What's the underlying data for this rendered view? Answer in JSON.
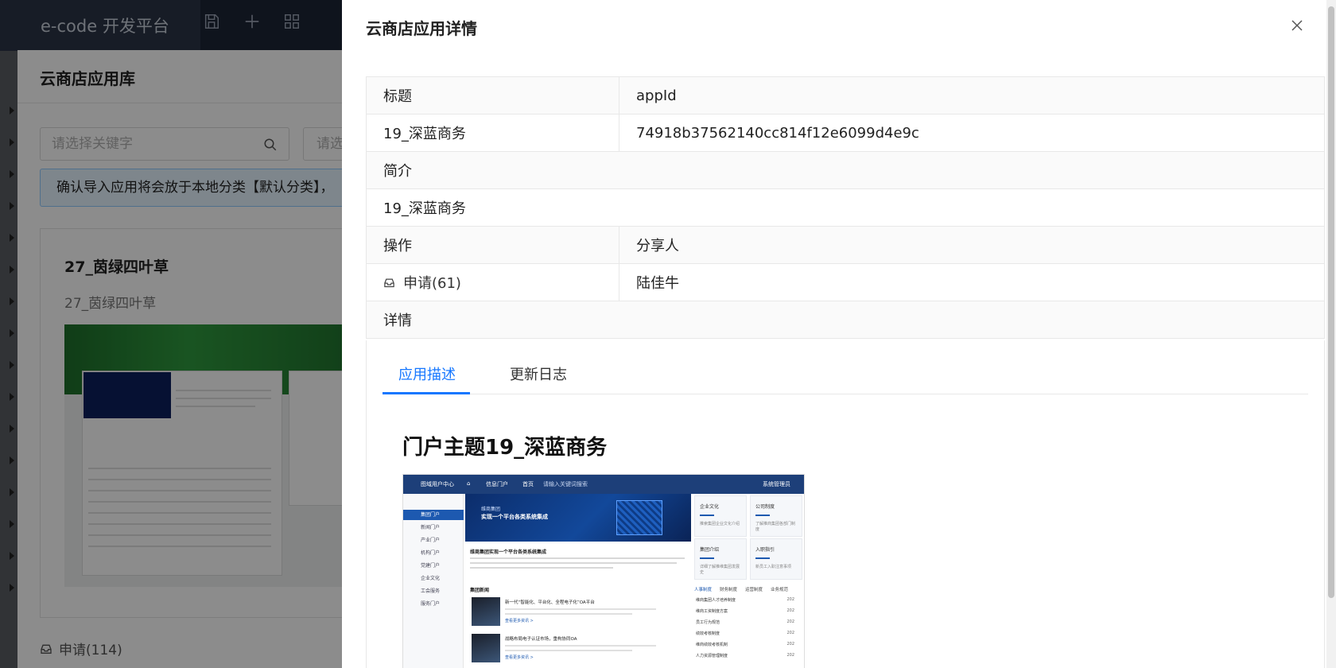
{
  "app": {
    "brand": "e-code 开发平台"
  },
  "library": {
    "title": "云商店应用库",
    "search_placeholder": "请选择关键字",
    "search2_placeholder": "请选",
    "alert_text": "确认导入应用将会放于本地分类【默认分类】，",
    "card": {
      "title": "27_茵绿四叶草",
      "subtitle": "27_茵绿四叶草"
    },
    "footer_apply": "申请(114)"
  },
  "drawer": {
    "title": "云商店应用详情",
    "table": {
      "title_label": "标题",
      "appid_label": "appId",
      "title_value": "19_深蓝商务",
      "appid_value": "74918b37562140cc814f12e6099d4e9c",
      "intro_label": "简介",
      "intro_value": "19_深蓝商务",
      "ops_label": "操作",
      "sharer_label": "分享人",
      "apply_label": "申请(61)",
      "sharer_value": "陆佳牛",
      "details_label": "详情"
    },
    "tabs": [
      "应用描述",
      "更新日志"
    ],
    "active_tab": 0,
    "description_title": "门户主题19_深蓝商务",
    "preview": {
      "top_title": "图域用户中心",
      "top_menu": "信息门户",
      "top_home": "首页",
      "top_search": "请输入关键词搜索",
      "top_user": "系统管理员",
      "side_items": [
        "集团门户",
        "新闻门户",
        "产业门户",
        "机构门户",
        "党建门户",
        "企业文化",
        "工会服务",
        "服务门户"
      ],
      "banner_kicker": "维商集团",
      "banner_title": "实现一个平台各类系统集成",
      "card_culture": "企业文化",
      "card_culture_desc": "推索集团企业文化介绍",
      "card_company": "公司制度",
      "card_company_desc": "了解推商集团各部门制度",
      "card_intro": "集团介绍",
      "card_intro_desc": "详细了解推维集团发展史",
      "card_guide": "入职指引",
      "card_guide_desc": "新员工入职注意事项",
      "headline": "维商集团实现一个平台各类系统集成",
      "news_title": "集团新闻",
      "news": [
        {
          "title": "新一代“智能化、平台化、全程电子化”OA平台",
          "more": "查看更多资讯 >"
        },
        {
          "title": "战略布局电子认证市场，重构协同OA",
          "more": "查看更多资讯 >"
        }
      ],
      "list_tabs": [
        "人事制度",
        "财务制度",
        "运营制度",
        "业务规范"
      ],
      "list_items": [
        {
          "text": "维商集团人才培养制度",
          "year": "202"
        },
        {
          "text": "维商工资制度方案",
          "year": "202"
        },
        {
          "text": "员工行为规范",
          "year": "202"
        },
        {
          "text": "绩效考核制度",
          "year": "202"
        },
        {
          "text": "维商绩效考核机制",
          "year": "202"
        },
        {
          "text": "人力资源管理制度",
          "year": "202"
        }
      ]
    }
  },
  "colors": {
    "accent": "#1677ff",
    "topbar": "#1d2536",
    "alert_bg": "#e6f4ff"
  },
  "icons": {
    "save": "save-icon",
    "add": "plus-icon",
    "grid": "grid-icon",
    "search": "search-icon",
    "close": "close-icon",
    "inbox": "inbox-icon"
  }
}
